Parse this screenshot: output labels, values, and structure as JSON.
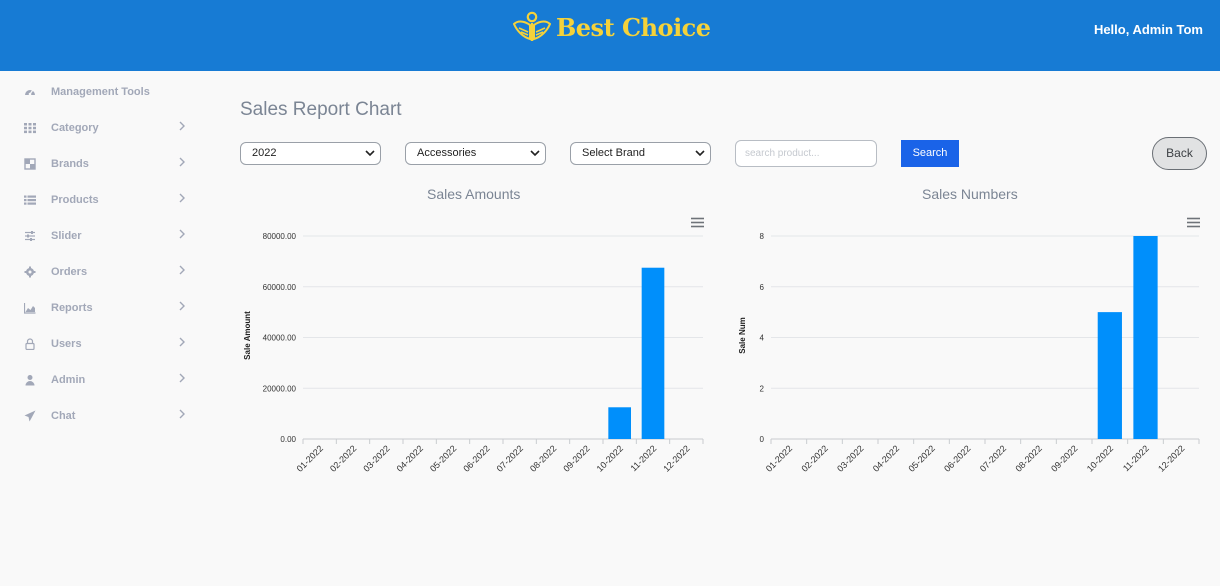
{
  "header": {
    "brand_name": "Best Choice",
    "brand_icon": "winged-logo-icon",
    "greeting": "Hello, Admin Tom",
    "background_color": "#177bd4",
    "brand_color": "#f5d23a"
  },
  "sidebar": {
    "items": [
      {
        "label": "Management Tools",
        "icon": "dashboard-icon",
        "has_chevron": false
      },
      {
        "label": "Category",
        "icon": "grid-icon",
        "has_chevron": true
      },
      {
        "label": "Brands",
        "icon": "brands-icon",
        "has_chevron": true
      },
      {
        "label": "Products",
        "icon": "list-icon",
        "has_chevron": true
      },
      {
        "label": "Slider",
        "icon": "sliders-icon",
        "has_chevron": true
      },
      {
        "label": "Orders",
        "icon": "gear-icon",
        "has_chevron": true
      },
      {
        "label": "Reports",
        "icon": "area-chart-icon",
        "has_chevron": true
      },
      {
        "label": "Users",
        "icon": "lock-icon",
        "has_chevron": true
      },
      {
        "label": "Admin",
        "icon": "user-icon",
        "has_chevron": true
      },
      {
        "label": "Chat",
        "icon": "paper-plane-icon",
        "has_chevron": true
      }
    ]
  },
  "main": {
    "title": "Sales Report Chart",
    "filters": {
      "year": "2022",
      "category": "Accessories",
      "brand": "Select Brand",
      "search_placeholder": "search product...",
      "search_button": "Search",
      "back_button": "Back"
    }
  },
  "chart_data": [
    {
      "type": "bar",
      "title": "Sales Amounts",
      "xlabel": "",
      "ylabel": "Sale Amount",
      "categories": [
        "01-2022",
        "02-2022",
        "03-2022",
        "04-2022",
        "05-2022",
        "06-2022",
        "07-2022",
        "08-2022",
        "09-2022",
        "10-2022",
        "11-2022",
        "12-2022"
      ],
      "values": [
        0,
        0,
        0,
        0,
        0,
        0,
        0,
        0,
        0,
        12500,
        67500,
        0
      ],
      "ylim": [
        0,
        80000
      ],
      "yticks": [
        "0.00",
        "20000.00",
        "40000.00",
        "60000.00",
        "80000.00"
      ],
      "ytick_values": [
        0,
        20000,
        40000,
        60000,
        80000
      ],
      "grid": true,
      "bar_color": "#008ffb"
    },
    {
      "type": "bar",
      "title": "Sales Numbers",
      "xlabel": "",
      "ylabel": "Sale Num",
      "categories": [
        "01-2022",
        "02-2022",
        "03-2022",
        "04-2022",
        "05-2022",
        "06-2022",
        "07-2022",
        "08-2022",
        "09-2022",
        "10-2022",
        "11-2022",
        "12-2022"
      ],
      "values": [
        0,
        0,
        0,
        0,
        0,
        0,
        0,
        0,
        0,
        5,
        8,
        0
      ],
      "ylim": [
        0,
        8
      ],
      "yticks": [
        "0",
        "2",
        "4",
        "6",
        "8"
      ],
      "ytick_values": [
        0,
        2,
        4,
        6,
        8
      ],
      "grid": true,
      "bar_color": "#008ffb"
    }
  ]
}
